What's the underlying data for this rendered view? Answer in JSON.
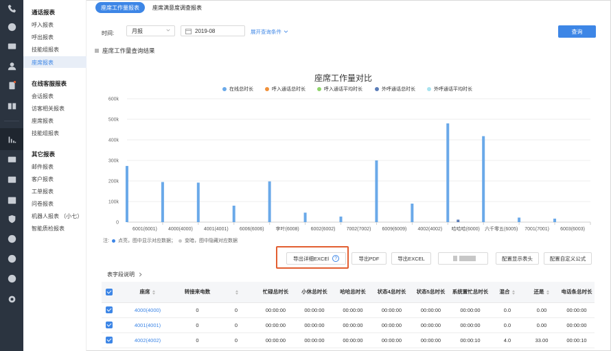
{
  "nav": {
    "groups": [
      {
        "title": "通话报表",
        "items": [
          "呼入报表",
          "呼出报表",
          "技能组报表",
          "座席报表"
        ]
      },
      {
        "title": "在线客服报表",
        "items": [
          "会话报表",
          "访客相关报表",
          "座席报表",
          "技能组报表"
        ]
      },
      {
        "title": "其它报表",
        "items": [
          "邮件报表",
          "客户报表",
          "工单报表",
          "问卷报表",
          "机器人报表 （小七）",
          "智能质检报表"
        ]
      }
    ],
    "active_item": "座席报表"
  },
  "tabs": [
    "座席工作量报表",
    "座席满意度调查报表"
  ],
  "filters": {
    "time_label": "时间:",
    "period_value": "月报",
    "date_value": "2019-08",
    "expand_label": "展开查询条件",
    "query_button": "查询"
  },
  "section_title": "座席工作量查询结果",
  "chart_data": {
    "type": "bar",
    "title": "座席工作量对比",
    "categories": [
      "6001(6001)",
      "4000(4000)",
      "4001(4001)",
      "6006(6006)",
      "李叶(6008)",
      "6002(6002)",
      "7002(7002)",
      "6009(6009)",
      "4002(4002)",
      "哈哈哈(6000)",
      "六千零五(6005)",
      "7001(7001)",
      "6003(6003)"
    ],
    "series": [
      {
        "name": "在线总时长",
        "color": "#6aa9e9",
        "values": [
          273000,
          195000,
          192000,
          80000,
          198000,
          46000,
          27000,
          300000,
          90000,
          480000,
          418000,
          22000,
          17000
        ]
      },
      {
        "name": "呼入通话总时长",
        "color": "#f0913a",
        "values": [
          0,
          0,
          0,
          0,
          0,
          0,
          0,
          0,
          0,
          0,
          0,
          0,
          0
        ]
      },
      {
        "name": "呼入通话平均时长",
        "color": "#8fd46b",
        "values": [
          0,
          0,
          0,
          0,
          0,
          0,
          0,
          0,
          0,
          0,
          0,
          0,
          0
        ]
      },
      {
        "name": "外呼通话总时长",
        "color": "#5b7db8",
        "values": [
          0,
          0,
          0,
          0,
          0,
          0,
          0,
          0,
          0,
          12000,
          0,
          0,
          0
        ]
      },
      {
        "name": "外呼通话平均时长",
        "color": "#a8e3ef",
        "values": [
          0,
          0,
          0,
          0,
          0,
          0,
          0,
          0,
          0,
          0,
          0,
          0,
          0
        ]
      }
    ],
    "yticks": [
      "0",
      "100k",
      "200k",
      "300k",
      "400k",
      "500k",
      "600k"
    ],
    "ylim": [
      0,
      600000
    ],
    "legend": "top"
  },
  "chart_note": {
    "prefix": "注:",
    "item1": "点亮，图中显示对应数据；",
    "item2": "变暗，图中隐藏对应数据"
  },
  "buttons": {
    "export_detail": "导出详细EXCEl",
    "help_icon": "?",
    "export_pdf": "导出PDF",
    "export_excel": "导出EXCEL",
    "config_header": "配置显示表头",
    "config_formula": "配置自定义公式"
  },
  "field_desc": "表字段说明",
  "table": {
    "headers": [
      "座席",
      "转接来电数",
      "",
      "忙碌总时长",
      "小休总时长",
      "哈哈总时长",
      "状态4总时长",
      "状态5总时长",
      "系统置忙总时长",
      "混合",
      "还是",
      "电话条总时长"
    ],
    "rows": [
      [
        "4000(4000)",
        "0",
        "0",
        "00:00:00",
        "00:00:00",
        "00:00:00",
        "00:00:00",
        "00:00:00",
        "00:00:00",
        "0.0",
        "0.00",
        "00:00:00"
      ],
      [
        "4001(4001)",
        "0",
        "0",
        "00:00:00",
        "00:00:00",
        "00:00:00",
        "00:00:00",
        "00:00:00",
        "00:00:00",
        "0.0",
        "0.00",
        "00:00:00"
      ],
      [
        "4002(4002)",
        "0",
        "0",
        "00:00:00",
        "00:00:00",
        "00:00:00",
        "00:00:00",
        "00:00:00",
        "00:00:10",
        "4.0",
        "33.00",
        "00:00:10"
      ]
    ]
  }
}
